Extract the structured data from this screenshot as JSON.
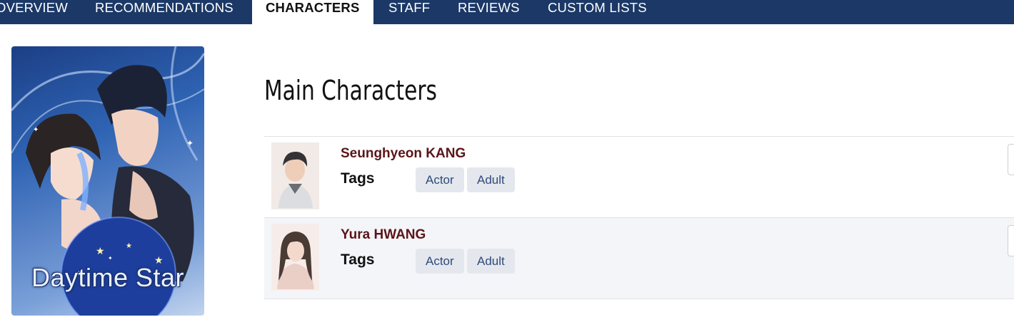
{
  "nav": {
    "tabs": [
      {
        "label": "OVERVIEW"
      },
      {
        "label": "RECOMMENDATIONS"
      },
      {
        "label": "CHARACTERS",
        "active": true
      },
      {
        "label": "STAFF"
      },
      {
        "label": "REVIEWS"
      },
      {
        "label": "CUSTOM LISTS"
      }
    ]
  },
  "cover": {
    "title": "Daytime Star"
  },
  "main": {
    "section_title": "Main Characters",
    "characters": [
      {
        "name": "Seunghyeon KANG",
        "tags_label": "Tags",
        "tags": [
          "Actor",
          "Adult"
        ]
      },
      {
        "name": "Yura HWANG",
        "tags_label": "Tags",
        "tags": [
          "Actor",
          "Adult"
        ]
      }
    ]
  },
  "colors": {
    "nav_background": "#1b3866",
    "name_color": "#5a1518",
    "tag_background": "#e4e7ed",
    "tag_text": "#2e4a7a"
  }
}
